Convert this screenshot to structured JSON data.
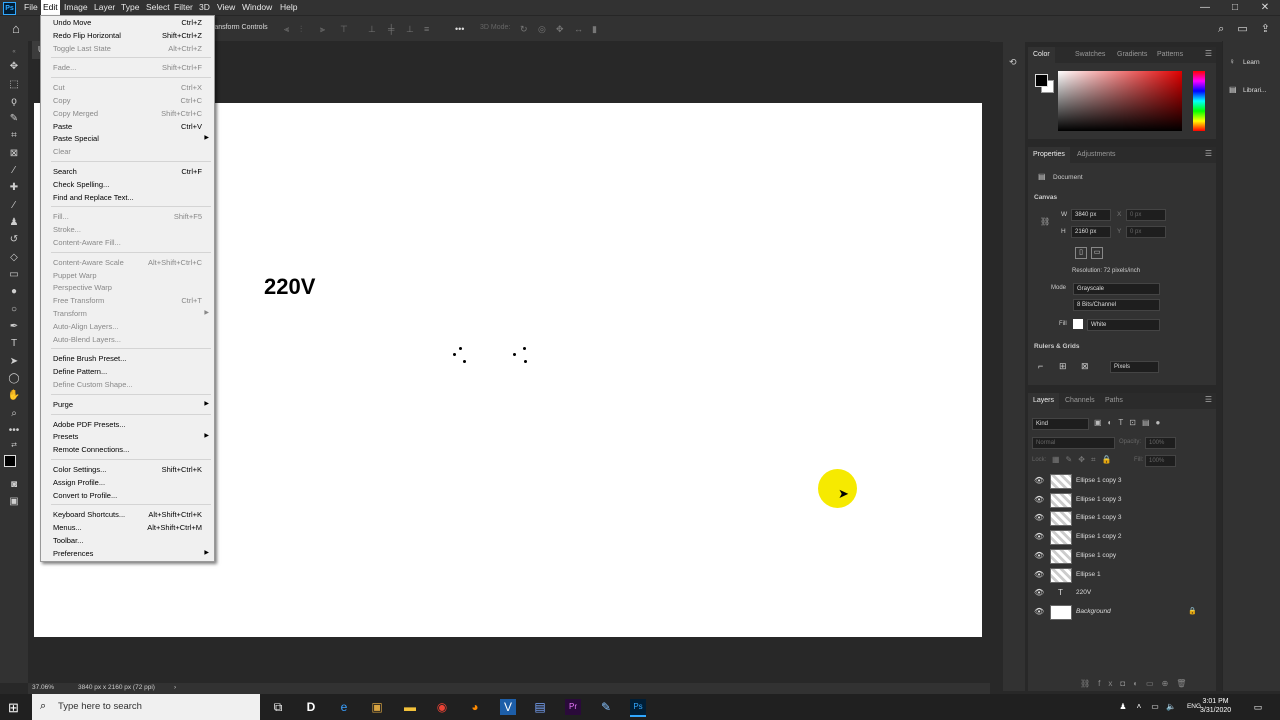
{
  "menubar": {
    "items": [
      "File",
      "Edit",
      "Image",
      "Layer",
      "Type",
      "Select",
      "Filter",
      "3D",
      "View",
      "Window",
      "Help"
    ],
    "active": "Edit",
    "window_buttons": [
      "—",
      "□",
      "✕"
    ]
  },
  "optionsbar": {
    "label": "ransform Controls",
    "mode_3d": "3D Mode:"
  },
  "document_tab": {
    "label": "U"
  },
  "canvas": {
    "text": "220V",
    "background": "#ffffff"
  },
  "statusbar": {
    "zoom": "37.06%",
    "doc_info": "3840 px x 2160 px (72 ppi)",
    "arrow": "›"
  },
  "edit_menu": {
    "items": [
      {
        "label": "Undo Move",
        "shortcut": "Ctrl+Z",
        "enabled": true
      },
      {
        "label": "Redo Flip Horizontal",
        "shortcut": "Shift+Ctrl+Z",
        "enabled": true
      },
      {
        "label": "Toggle Last State",
        "shortcut": "Alt+Ctrl+Z",
        "enabled": false
      },
      {
        "sep": true
      },
      {
        "label": "Fade...",
        "shortcut": "Shift+Ctrl+F",
        "enabled": false
      },
      {
        "sep": true
      },
      {
        "label": "Cut",
        "shortcut": "Ctrl+X",
        "enabled": false
      },
      {
        "label": "Copy",
        "shortcut": "Ctrl+C",
        "enabled": false
      },
      {
        "label": "Copy Merged",
        "shortcut": "Shift+Ctrl+C",
        "enabled": false
      },
      {
        "label": "Paste",
        "shortcut": "Ctrl+V",
        "enabled": true
      },
      {
        "label": "Paste Special",
        "shortcut": "",
        "enabled": true,
        "submenu": true
      },
      {
        "label": "Clear",
        "shortcut": "",
        "enabled": false
      },
      {
        "sep": true
      },
      {
        "label": "Search",
        "shortcut": "Ctrl+F",
        "enabled": true
      },
      {
        "label": "Check Spelling...",
        "shortcut": "",
        "enabled": true
      },
      {
        "label": "Find and Replace Text...",
        "shortcut": "",
        "enabled": true
      },
      {
        "sep": true
      },
      {
        "label": "Fill...",
        "shortcut": "Shift+F5",
        "enabled": false
      },
      {
        "label": "Stroke...",
        "shortcut": "",
        "enabled": false
      },
      {
        "label": "Content-Aware Fill...",
        "shortcut": "",
        "enabled": false
      },
      {
        "sep": true
      },
      {
        "label": "Content-Aware Scale",
        "shortcut": "Alt+Shift+Ctrl+C",
        "enabled": false
      },
      {
        "label": "Puppet Warp",
        "shortcut": "",
        "enabled": false
      },
      {
        "label": "Perspective Warp",
        "shortcut": "",
        "enabled": false
      },
      {
        "label": "Free Transform",
        "shortcut": "Ctrl+T",
        "enabled": false
      },
      {
        "label": "Transform",
        "shortcut": "",
        "enabled": false,
        "submenu": true
      },
      {
        "label": "Auto-Align Layers...",
        "shortcut": "",
        "enabled": false
      },
      {
        "label": "Auto-Blend Layers...",
        "shortcut": "",
        "enabled": false
      },
      {
        "sep": true
      },
      {
        "label": "Define Brush Preset...",
        "shortcut": "",
        "enabled": true
      },
      {
        "label": "Define Pattern...",
        "shortcut": "",
        "enabled": true
      },
      {
        "label": "Define Custom Shape...",
        "shortcut": "",
        "enabled": false
      },
      {
        "sep": true
      },
      {
        "label": "Purge",
        "shortcut": "",
        "enabled": true,
        "submenu": true
      },
      {
        "sep": true
      },
      {
        "label": "Adobe PDF Presets...",
        "shortcut": "",
        "enabled": true
      },
      {
        "label": "Presets",
        "shortcut": "",
        "enabled": true,
        "submenu": true
      },
      {
        "label": "Remote Connections...",
        "shortcut": "",
        "enabled": true
      },
      {
        "sep": true
      },
      {
        "label": "Color Settings...",
        "shortcut": "Shift+Ctrl+K",
        "enabled": true
      },
      {
        "label": "Assign Profile...",
        "shortcut": "",
        "enabled": true
      },
      {
        "label": "Convert to Profile...",
        "shortcut": "",
        "enabled": true
      },
      {
        "sep": true
      },
      {
        "label": "Keyboard Shortcuts...",
        "shortcut": "Alt+Shift+Ctrl+K",
        "enabled": true
      },
      {
        "label": "Menus...",
        "shortcut": "Alt+Shift+Ctrl+M",
        "enabled": true
      },
      {
        "label": "Toolbar...",
        "shortcut": "",
        "enabled": true
      },
      {
        "label": "Preferences",
        "shortcut": "",
        "enabled": true,
        "submenu": true
      }
    ]
  },
  "color_panel": {
    "tabs": [
      "Color",
      "Swatches",
      "Gradients",
      "Patterns"
    ],
    "active": "Color"
  },
  "properties_panel": {
    "tabs": [
      "Properties",
      "Adjustments"
    ],
    "section": "Document",
    "canvas_heading": "Canvas",
    "w_label": "W",
    "w_value": "3840 px",
    "h_label": "H",
    "h_value": "2160 px",
    "x_label": "X",
    "x_value": "0 px",
    "y_label": "Y",
    "y_value": "0 px",
    "resolution": "Resolution: 72 pixels/inch",
    "mode_label": "Mode",
    "mode_value": "Grayscale",
    "depth_value": "8 Bits/Channel",
    "fill_label": "Fill",
    "fill_value": "White",
    "rulers_heading": "Rulers & Grids",
    "units_value": "Pixels"
  },
  "layers_panel": {
    "tabs": [
      "Layers",
      "Channels",
      "Paths"
    ],
    "kind": "Kind",
    "blend": "Normal",
    "opacity_label": "Opacity:",
    "opacity_value": "100%",
    "lock_label": "Lock:",
    "fill_label": "Fill:",
    "fill_value": "100%",
    "layers": [
      {
        "name": "Ellipse 1 copy 3",
        "type": "shape"
      },
      {
        "name": "Ellipse 1 copy 3",
        "type": "shape"
      },
      {
        "name": "Ellipse 1 copy 3",
        "type": "shape"
      },
      {
        "name": "Ellipse 1 copy 2",
        "type": "shape"
      },
      {
        "name": "Ellipse 1 copy",
        "type": "shape"
      },
      {
        "name": "Ellipse 1",
        "type": "shape"
      },
      {
        "name": "220V",
        "type": "text"
      },
      {
        "name": "Background",
        "type": "background"
      }
    ]
  },
  "learn_strip": {
    "items": [
      "Learn",
      "Librari..."
    ]
  },
  "taskbar": {
    "search_placeholder": "Type here to search",
    "time": "3:01 PM",
    "date": "3/31/2020",
    "lang": "ENG"
  }
}
